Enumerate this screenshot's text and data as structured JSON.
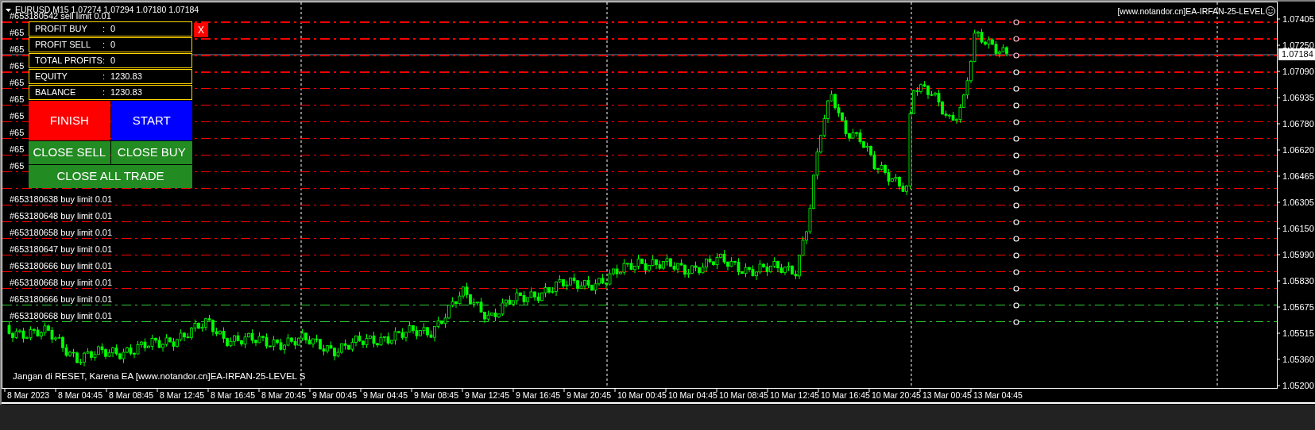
{
  "chart": {
    "symbol_info": "EURUSD,M15  1.07274 1.07294 1.07180 1.07184",
    "ea_label": "[www.notandor.cn]EA-IRFAN-25-LEVEL",
    "comment": "Jangan di RESET, Karena EA [www.notandor.cn]EA-IRFAN-25-LEVEL S",
    "current_price": "1.07184",
    "price_ticks": [
      "1.07405",
      "1.07250",
      "1.07090",
      "1.06935",
      "1.06780",
      "1.06620",
      "1.06465",
      "1.06305",
      "1.06150",
      "1.05990",
      "1.05830",
      "1.05675",
      "1.05515",
      "1.05360",
      "1.05200"
    ],
    "time_ticks": [
      "8 Mar 2023",
      "8 Mar 04:45",
      "8 Mar 08:45",
      "8 Mar 12:45",
      "8 Mar 16:45",
      "8 Mar 20:45",
      "9 Mar 00:45",
      "9 Mar 04:45",
      "9 Mar 08:45",
      "9 Mar 12:45",
      "9 Mar 16:45",
      "9 Mar 20:45",
      "10 Mar 00:45",
      "10 Mar 04:45",
      "10 Mar 08:45",
      "10 Mar 12:45",
      "10 Mar 16:45",
      "10 Mar 20:45",
      "13 Mar 00:45",
      "13 Mar 04:45"
    ],
    "orders": [
      {
        "label": "#653180542 sell limit 0.01",
        "color": "#ff0000"
      },
      {
        "label": "#65",
        "color": "#ff0000"
      },
      {
        "label": "#65",
        "color": "#ff0000"
      },
      {
        "label": "#65",
        "color": "#ff0000"
      },
      {
        "label": "#65",
        "color": "#ff0000"
      },
      {
        "label": "#65",
        "color": "#ff0000"
      },
      {
        "label": "#65",
        "color": "#ff0000"
      },
      {
        "label": "#65",
        "color": "#ff0000"
      },
      {
        "label": "#65",
        "color": "#ff0000"
      },
      {
        "label": "#65",
        "color": "#ff0000"
      },
      {
        "color": "#ff0000"
      },
      {
        "label": "#653180638 buy limit 0.01",
        "color": "#ff0000"
      },
      {
        "label": "#653180648 buy limit 0.01",
        "color": "#ff0000"
      },
      {
        "label": "#653180658 buy limit 0.01",
        "color": "#ff0000"
      },
      {
        "label": "#653180647 buy limit 0.01",
        "color": "#ff0000"
      },
      {
        "label": "#653180666 buy limit 0.01",
        "color": "#ff0000"
      },
      {
        "label": "#653180668 buy limit 0.01",
        "color": "#ff0000"
      },
      {
        "label": "#653180666 buy limit 0.01",
        "color": "#32cd32"
      },
      {
        "label": "#653180668 buy limit 0.01",
        "color": "#32cd32"
      }
    ]
  },
  "panel": {
    "stats": [
      {
        "label": "PROFIT BUY",
        "separator": ":",
        "value": "0"
      },
      {
        "label": "PROFIT SELL",
        "separator": ":",
        "value": "0"
      },
      {
        "label": "TOTAL PROFITS",
        "separator": ":",
        "value": "0"
      },
      {
        "label": "EQUITY",
        "separator": ":",
        "value": "1230.83"
      },
      {
        "label": "BALANCE",
        "separator": ":",
        "value": "1230.83"
      }
    ],
    "close_label": "X",
    "button_rows": [
      [
        {
          "label": "FINISH",
          "color": "#ff0000"
        },
        {
          "label": "START",
          "color": "#0000ff"
        }
      ],
      [
        {
          "label": "CLOSE SELL",
          "color": "#228b22"
        },
        {
          "label": "CLOSE BUY",
          "color": "#228b22"
        }
      ],
      [
        {
          "label": "CLOSE ALL TRADE",
          "color": "#228b22"
        }
      ]
    ]
  }
}
